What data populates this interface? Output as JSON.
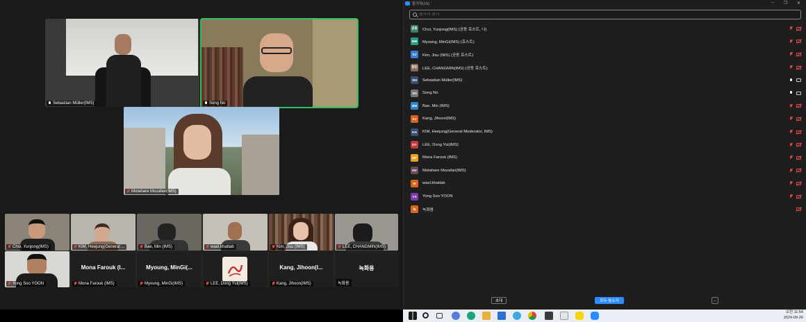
{
  "window": {
    "panel_title": "참가자(15)"
  },
  "gallery": {
    "top_tiles": [
      {
        "name": "Sebastian Müller(IMS)"
      },
      {
        "name": "Song No"
      },
      {
        "name": "Motahare Mozafari(IMS)"
      }
    ],
    "strip_row1": [
      {
        "name": "Choi, Yunjong(IMS)"
      },
      {
        "name": "KIM, Heejung(General ..."
      },
      {
        "name": "Bae, Min (IMS)"
      },
      {
        "name": "wael.khattab"
      },
      {
        "name": "Kim, Jisu (IMS)"
      },
      {
        "name": "LEE, CHANGMIN(IMS)"
      }
    ],
    "strip_row2": [
      {
        "name": "Yong Soo YOON",
        "display": ""
      },
      {
        "name": "Mona Farouk (IMS)",
        "display": "Mona Farouk (I..."
      },
      {
        "name": "Myoung, MinGi(IMS)",
        "display": "Myoung, MinGi(..."
      },
      {
        "name": "LEE, Dong Yul(IMS)",
        "display": ""
      },
      {
        "name": "Kang, Jihoon(IMS)",
        "display": "Kang, Jihoon(I..."
      },
      {
        "name": "녹화용",
        "display": "녹화용"
      }
    ]
  },
  "panel": {
    "search_placeholder": "참가자 찾기",
    "participants": [
      {
        "initials": "공동",
        "color": "#3b7d6b",
        "name": "Choi, Yunjong(IMS) (공동 호스트, 나)",
        "mic": "off",
        "cam": "off"
      },
      {
        "initials": "MM",
        "color": "#2b9e86",
        "name": "Myoung, MinGi(IMS) (호스트)",
        "mic": "off",
        "cam": "off"
      },
      {
        "initials": "KJ",
        "color": "#3a7dd1",
        "name": "Kim, Jisu (IMS) (공동 호스트)",
        "mic": "off",
        "cam": "off"
      },
      {
        "initials": "창민",
        "color": "#8a6a52",
        "name": "LEE, CHANGMIN(IMS) (공동 호스트)",
        "mic": "off",
        "cam": "off"
      },
      {
        "initials": "SM",
        "color": "#3a4f73",
        "name": "Sebastian Müller(IMS)",
        "mic": "on",
        "cam": "on"
      },
      {
        "initials": "SN",
        "color": "#777777",
        "name": "Song No",
        "mic": "on",
        "cam": "on"
      },
      {
        "initials": "BM",
        "color": "#2d86c9",
        "name": "Bae, Min (IMS)",
        "mic": "off",
        "cam": "off"
      },
      {
        "initials": "KJ",
        "color": "#d4641c",
        "name": "Kang, Jihoon(IMS)",
        "mic": "off",
        "cam": "off"
      },
      {
        "initials": "KH",
        "color": "#3a4f73",
        "name": "KIM, Heejung(General Moderator, IMS)",
        "mic": "off",
        "cam": "off"
      },
      {
        "initials": "DY",
        "color": "#c23a3a",
        "name": "LEE, Dong Yul(IMS)",
        "mic": "off",
        "cam": "off"
      },
      {
        "initials": "MF",
        "color": "#e8a21b",
        "name": "Mona Farouk (IMS)",
        "mic": "off",
        "cam": "off"
      },
      {
        "initials": "MZ",
        "color": "#6a4a5a",
        "name": "Motahare Mozafari(IMS)",
        "mic": "off",
        "cam": "off"
      },
      {
        "initials": "W",
        "color": "#d9641c",
        "name": "wael.khattab",
        "mic": "off",
        "cam": "off"
      },
      {
        "initials": "YS",
        "color": "#7a3bb0",
        "name": "Yong Soo YOON",
        "mic": "off",
        "cam": "off"
      },
      {
        "initials": "녹",
        "color": "#d9641c",
        "name": "녹화용",
        "mic": "none",
        "cam": "off"
      }
    ],
    "invite_label": "초대",
    "mute_all_label": "모두 음소거",
    "more_label": "..."
  },
  "taskbar": {
    "time": "오전 11:54",
    "date": "2024-09-26"
  },
  "colors": {
    "accent": "#2d8cff",
    "speaking": "#2fbf60",
    "muted": "#e04848"
  }
}
